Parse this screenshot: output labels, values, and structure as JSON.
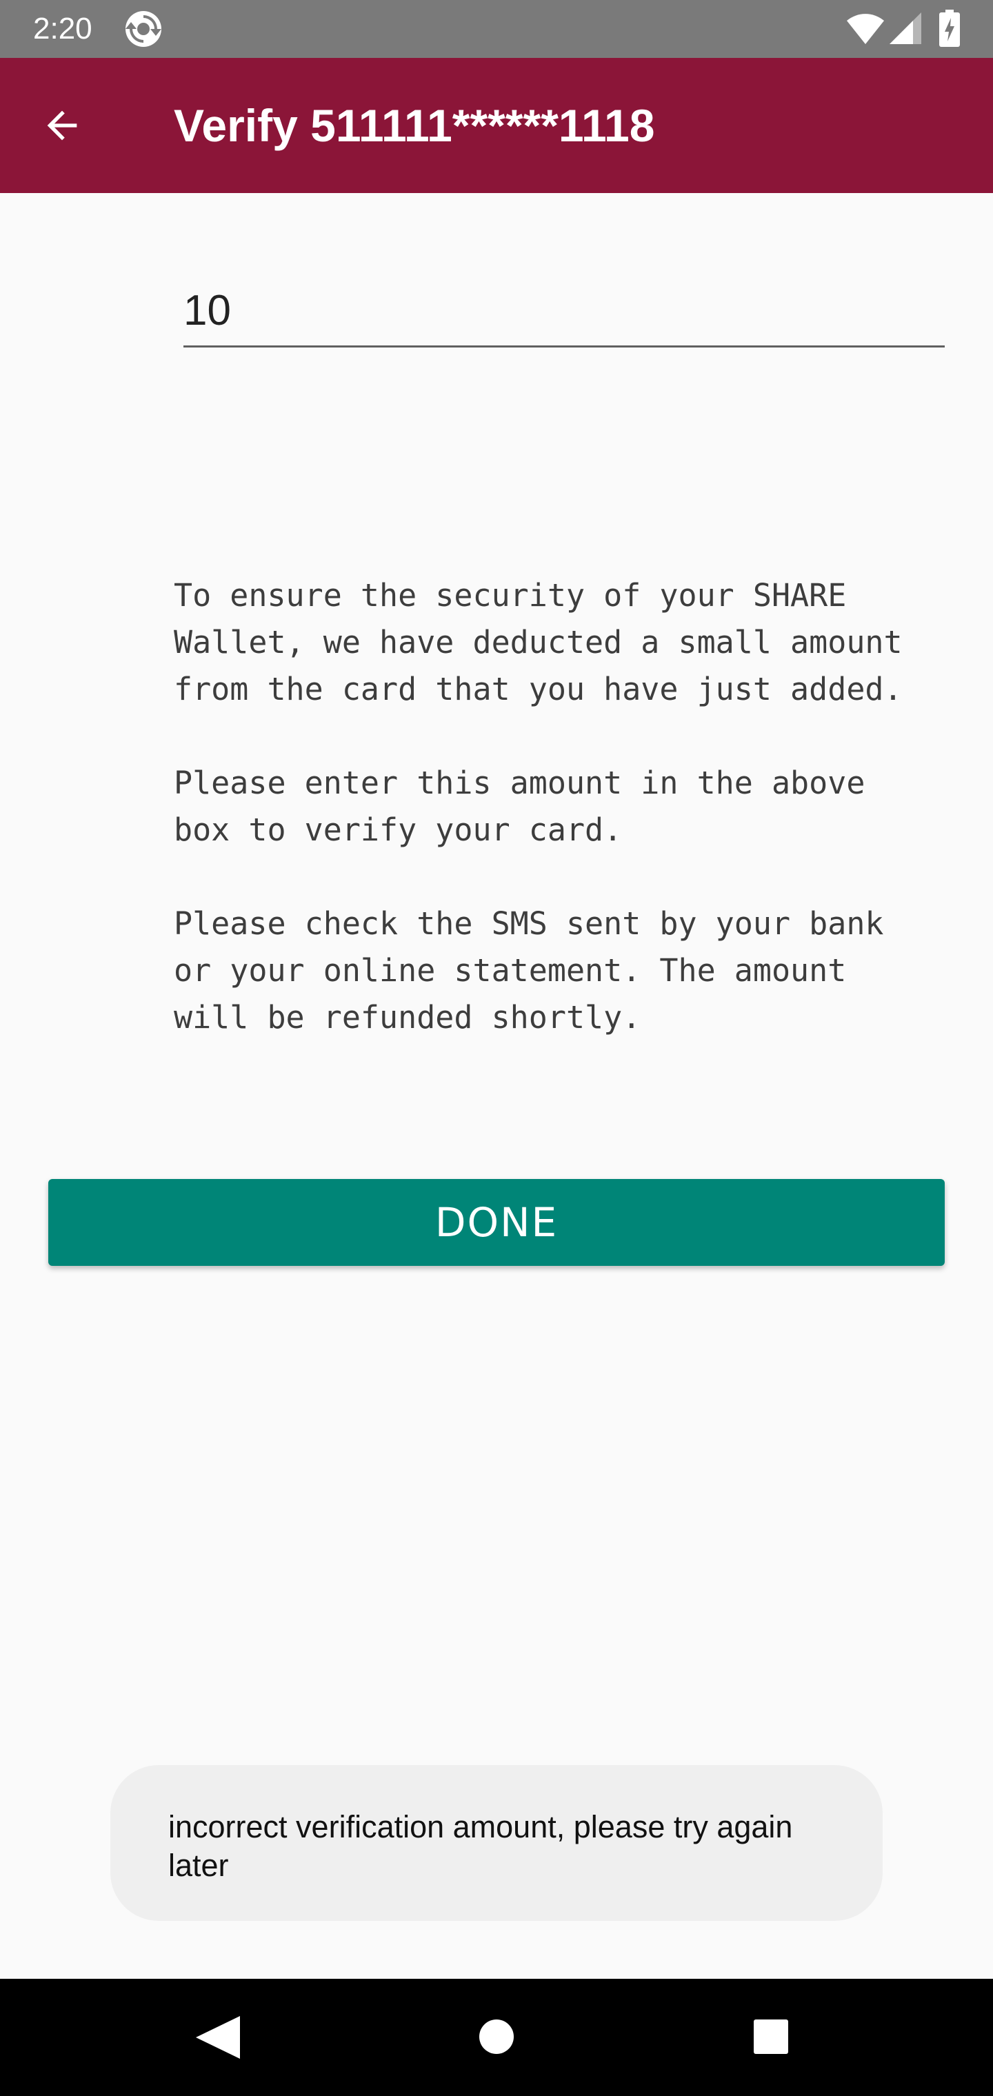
{
  "status_bar": {
    "time": "2:20",
    "icons": [
      "sync-icon",
      "wifi-icon",
      "signal-icon",
      "battery-icon"
    ]
  },
  "app_bar": {
    "title": "Verify 511111******1118",
    "back_icon": "arrow-left-icon",
    "background_color": "#8b1538"
  },
  "amount_input": {
    "value": "10"
  },
  "info": {
    "paragraphs": [
      "To ensure the security of your SHARE\nWallet, we have deducted a small amount\nfrom the card that you have just added.",
      "Please enter this amount in the above\nbox to verify your card.",
      "Please check the SMS sent by your bank\nor your online statement. The amount\nwill be refunded shortly."
    ]
  },
  "done_button": {
    "label": "DONE",
    "color": "#008577"
  },
  "toast": {
    "message": "incorrect verification amount, please try again later"
  },
  "nav_bar": {
    "icons": [
      "nav-back-icon",
      "nav-home-icon",
      "nav-recents-icon"
    ]
  }
}
